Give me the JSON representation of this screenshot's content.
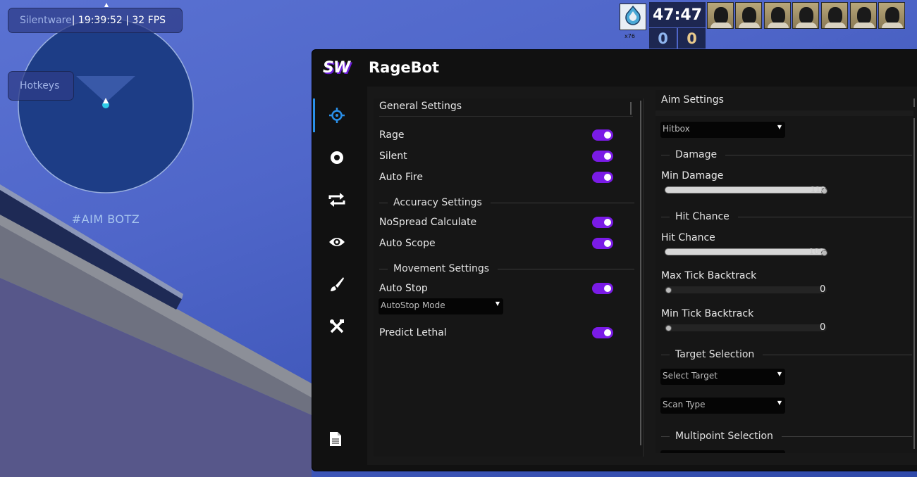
{
  "overlay": {
    "watermark_brand": "Silentware",
    "watermark_info": " | 19:39:52 | 32 FPS",
    "hotkeys_label": "Hotkeys",
    "radar_label": "#AIM BOTZ"
  },
  "scoreboard": {
    "timer": "47:47",
    "ct_score": "0",
    "t_score": "0",
    "emblem_sub": "x76",
    "players": [
      "player",
      "player",
      "player",
      "player",
      "player",
      "player",
      "player"
    ]
  },
  "menu": {
    "logo": "SW",
    "title": "RageBot",
    "sidebar": [
      "crosshair-icon",
      "target-dot-icon",
      "swap-icon",
      "eye-icon",
      "brush-icon",
      "tools-icon",
      "file-icon"
    ],
    "accent_color": "#7a1be6"
  },
  "left": {
    "general_header": "General Settings",
    "rage": "Rage",
    "silent": "Silent",
    "auto_fire": "Auto Fire",
    "accuracy_header": "Accuracy Settings",
    "nospread": "NoSpread Calculate",
    "auto_scope": "Auto Scope",
    "movement_header": "Movement Settings",
    "auto_stop": "Auto Stop",
    "autostop_mode": "AutoStop Mode",
    "predict_lethal": "Predict Lethal"
  },
  "right": {
    "aim_header": "Aim Settings",
    "hitbox": "Hitbox",
    "damage_header": "Damage",
    "min_damage": "Min Damage",
    "min_damage_val": "110",
    "hitchance_header": "Hit Chance",
    "hit_chance": "Hit Chance",
    "hit_chance_val": "100",
    "max_tick": "Max Tick Backtrack",
    "max_tick_val": "0",
    "min_tick": "Min Tick Backtrack",
    "min_tick_val": "0",
    "target_header": "Target Selection",
    "select_target": "Select Target",
    "scan_type": "Scan Type",
    "multipoint_header": "Multipoint Selection"
  }
}
